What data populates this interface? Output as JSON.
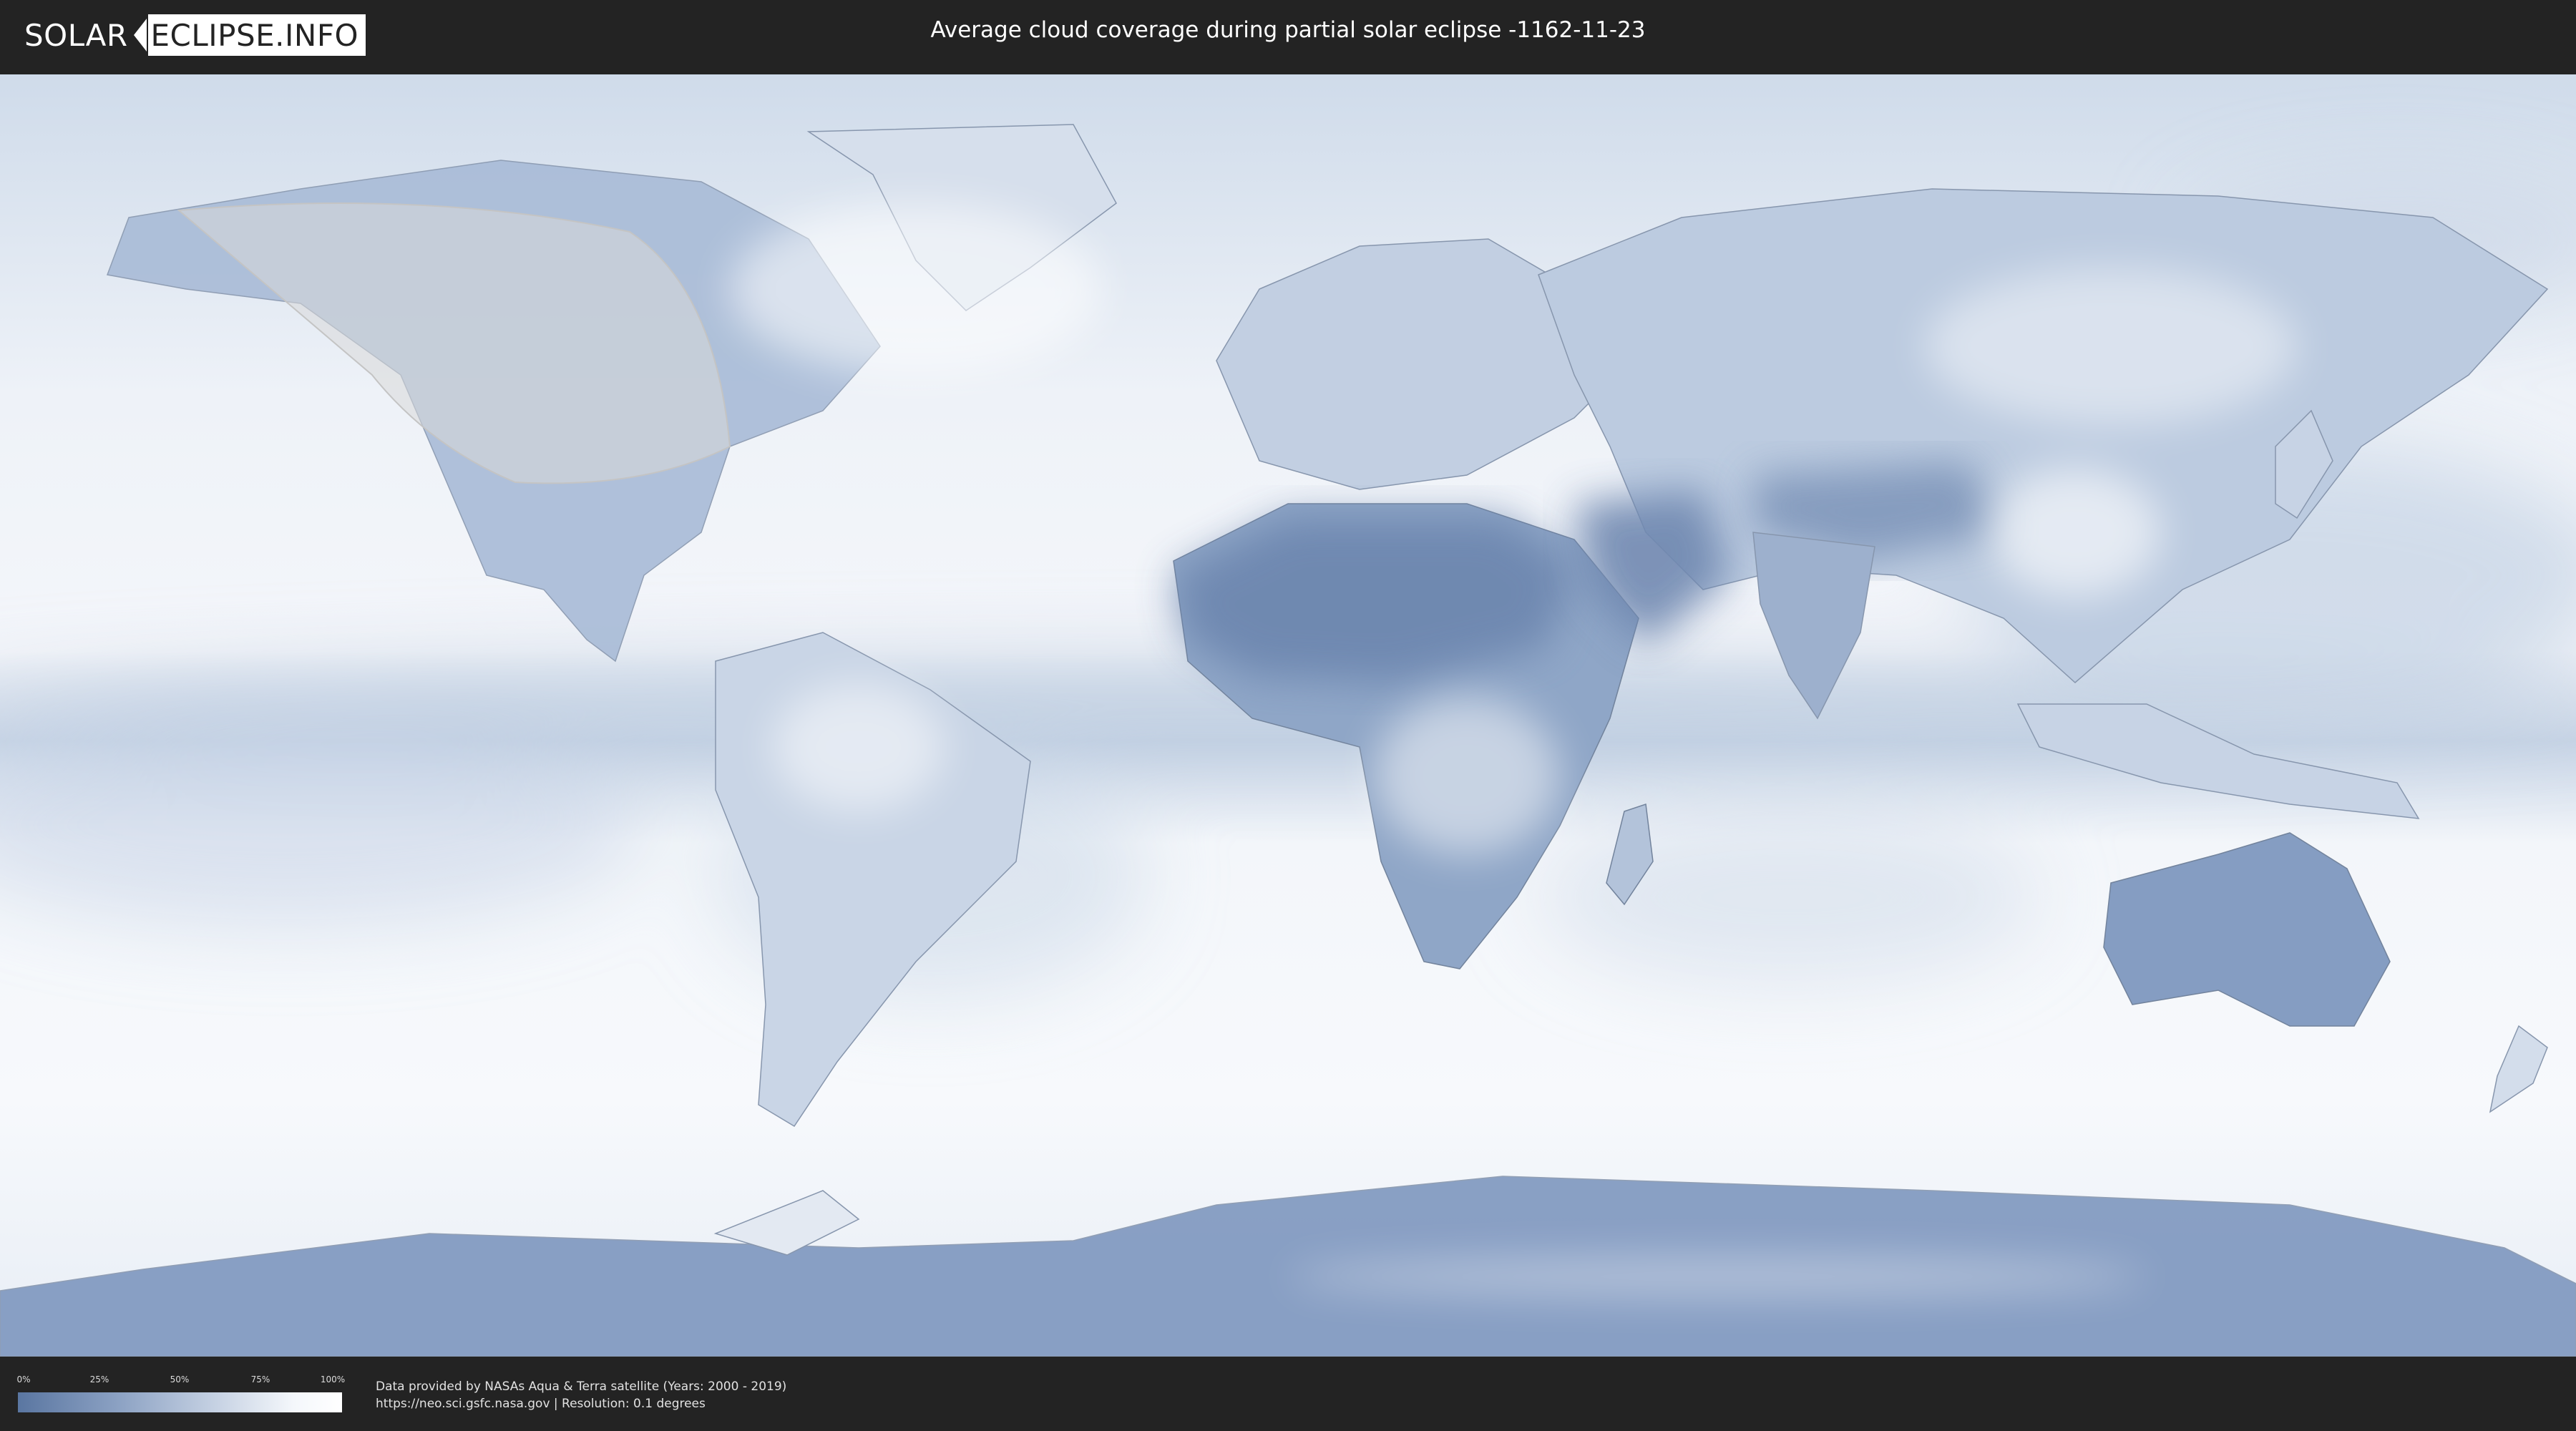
{
  "header": {
    "brand_left": "SOLAR",
    "brand_right": "ECLIPSE.INFO",
    "title": "Average cloud coverage during partial solar eclipse -1162-11-23"
  },
  "legend": {
    "ticks": [
      "0%",
      "25%",
      "50%",
      "75%",
      "100%"
    ],
    "gradient_colors": [
      "#5a76a1",
      "#ffffff"
    ]
  },
  "footer": {
    "credit_line_1": "Data provided by NASAs Aqua & Terra satellite (Years: 2000 - 2019)",
    "credit_line_2": "https://neo.sci.gsfc.nasa.gov | Resolution: 0.1 degrees"
  },
  "map": {
    "eclipse_visibility_area": "partial eclipse region over North America",
    "colors": {
      "ocean_cloud": "#f1f4f9",
      "clear_land": "#5f7ca7",
      "mid_cloud": "#a9bad4",
      "eclipse_overlay": "#d9d9d9"
    }
  }
}
